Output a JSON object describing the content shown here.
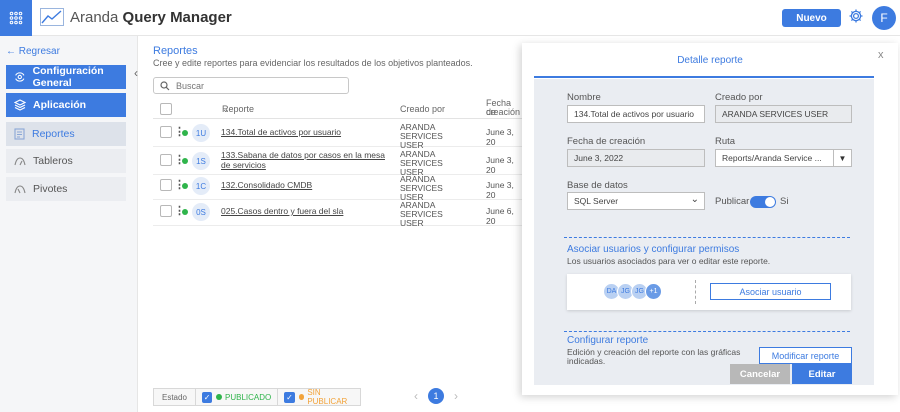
{
  "app": {
    "brand_light": "Aranda",
    "brand_bold": "Query Manager",
    "new_button": "Nuevo",
    "user_initial": "F"
  },
  "sidebar": {
    "back": "← Regresar",
    "items": [
      {
        "label": "Configuración General",
        "icon": "gear-icon"
      },
      {
        "label": "Aplicación",
        "icon": "layers-icon"
      },
      {
        "label": "Reportes",
        "icon": "report-icon"
      },
      {
        "label": "Tableros",
        "icon": "dashboard-icon"
      },
      {
        "label": "Pivotes",
        "icon": "pivot-icon"
      }
    ]
  },
  "main": {
    "title": "Reportes",
    "description": "Cree y edite reportes para evidenciar los resultados de los objetivos planteados.",
    "search_placeholder": "Buscar",
    "columns": {
      "report": "Reporte",
      "created_by": "Creado por",
      "created_date_1": "Fecha de",
      "created_date_2": "creación"
    },
    "rows": [
      {
        "code": "1U",
        "name": "134.Total de activos por usuario",
        "creator_1": "ARANDA SERVICES",
        "creator_2": "USER",
        "date": "June 3, 20"
      },
      {
        "code": "1S",
        "name": "133.Sabana de datos por casos en la mesa de servicios",
        "creator_1": "ARANDA SERVICES",
        "creator_2": "USER",
        "date": "June 3, 20"
      },
      {
        "code": "1C",
        "name": "132.Consolidado CMDB",
        "creator_1": "ARANDA SERVICES",
        "creator_2": "USER",
        "date": "June 3, 20"
      },
      {
        "code": "0S",
        "name": "025.Casos dentro y fuera del sla",
        "creator_1": "ARANDA SERVICES",
        "creator_2": "USER",
        "date": "June 6, 20"
      }
    ],
    "filters": {
      "label": "Estado",
      "published": "PUBLICADO",
      "unpublished": "SIN PUBLICAR"
    },
    "pager": {
      "current": "1"
    }
  },
  "panel": {
    "title": "Detalle reporte",
    "close": "x",
    "name_label": "Nombre",
    "name_value": "134.Total de activos por usuario",
    "created_by_label": "Creado por",
    "created_by_value": "ARANDA SERVICES USER",
    "date_label": "Fecha de creación",
    "date_value": "June 3, 2022",
    "route_label": "Ruta",
    "route_value": "Reports/Aranda Service ...",
    "db_label": "Base de datos",
    "db_value": "SQL Server",
    "publish_label": "Publicar",
    "publish_state": "Si",
    "assoc_title": "Asociar usuarios y configurar permisos",
    "assoc_desc": "Los usuarios asociados para ver o editar este reporte.",
    "avatars": [
      "DA",
      "JG",
      "JG",
      "+1"
    ],
    "assoc_button": "Asociar usuario",
    "config_title": "Configurar reporte",
    "config_desc_1": "Edición y creación del reporte con las gráficas",
    "config_desc_2": "indicadas.",
    "modify_button": "Modificar reporte",
    "cancel_button": "Cancelar",
    "edit_button": "Editar"
  },
  "colors": {
    "accent": "#3d7be0",
    "published": "#2fb44b",
    "unpublished": "#f2a33a"
  }
}
